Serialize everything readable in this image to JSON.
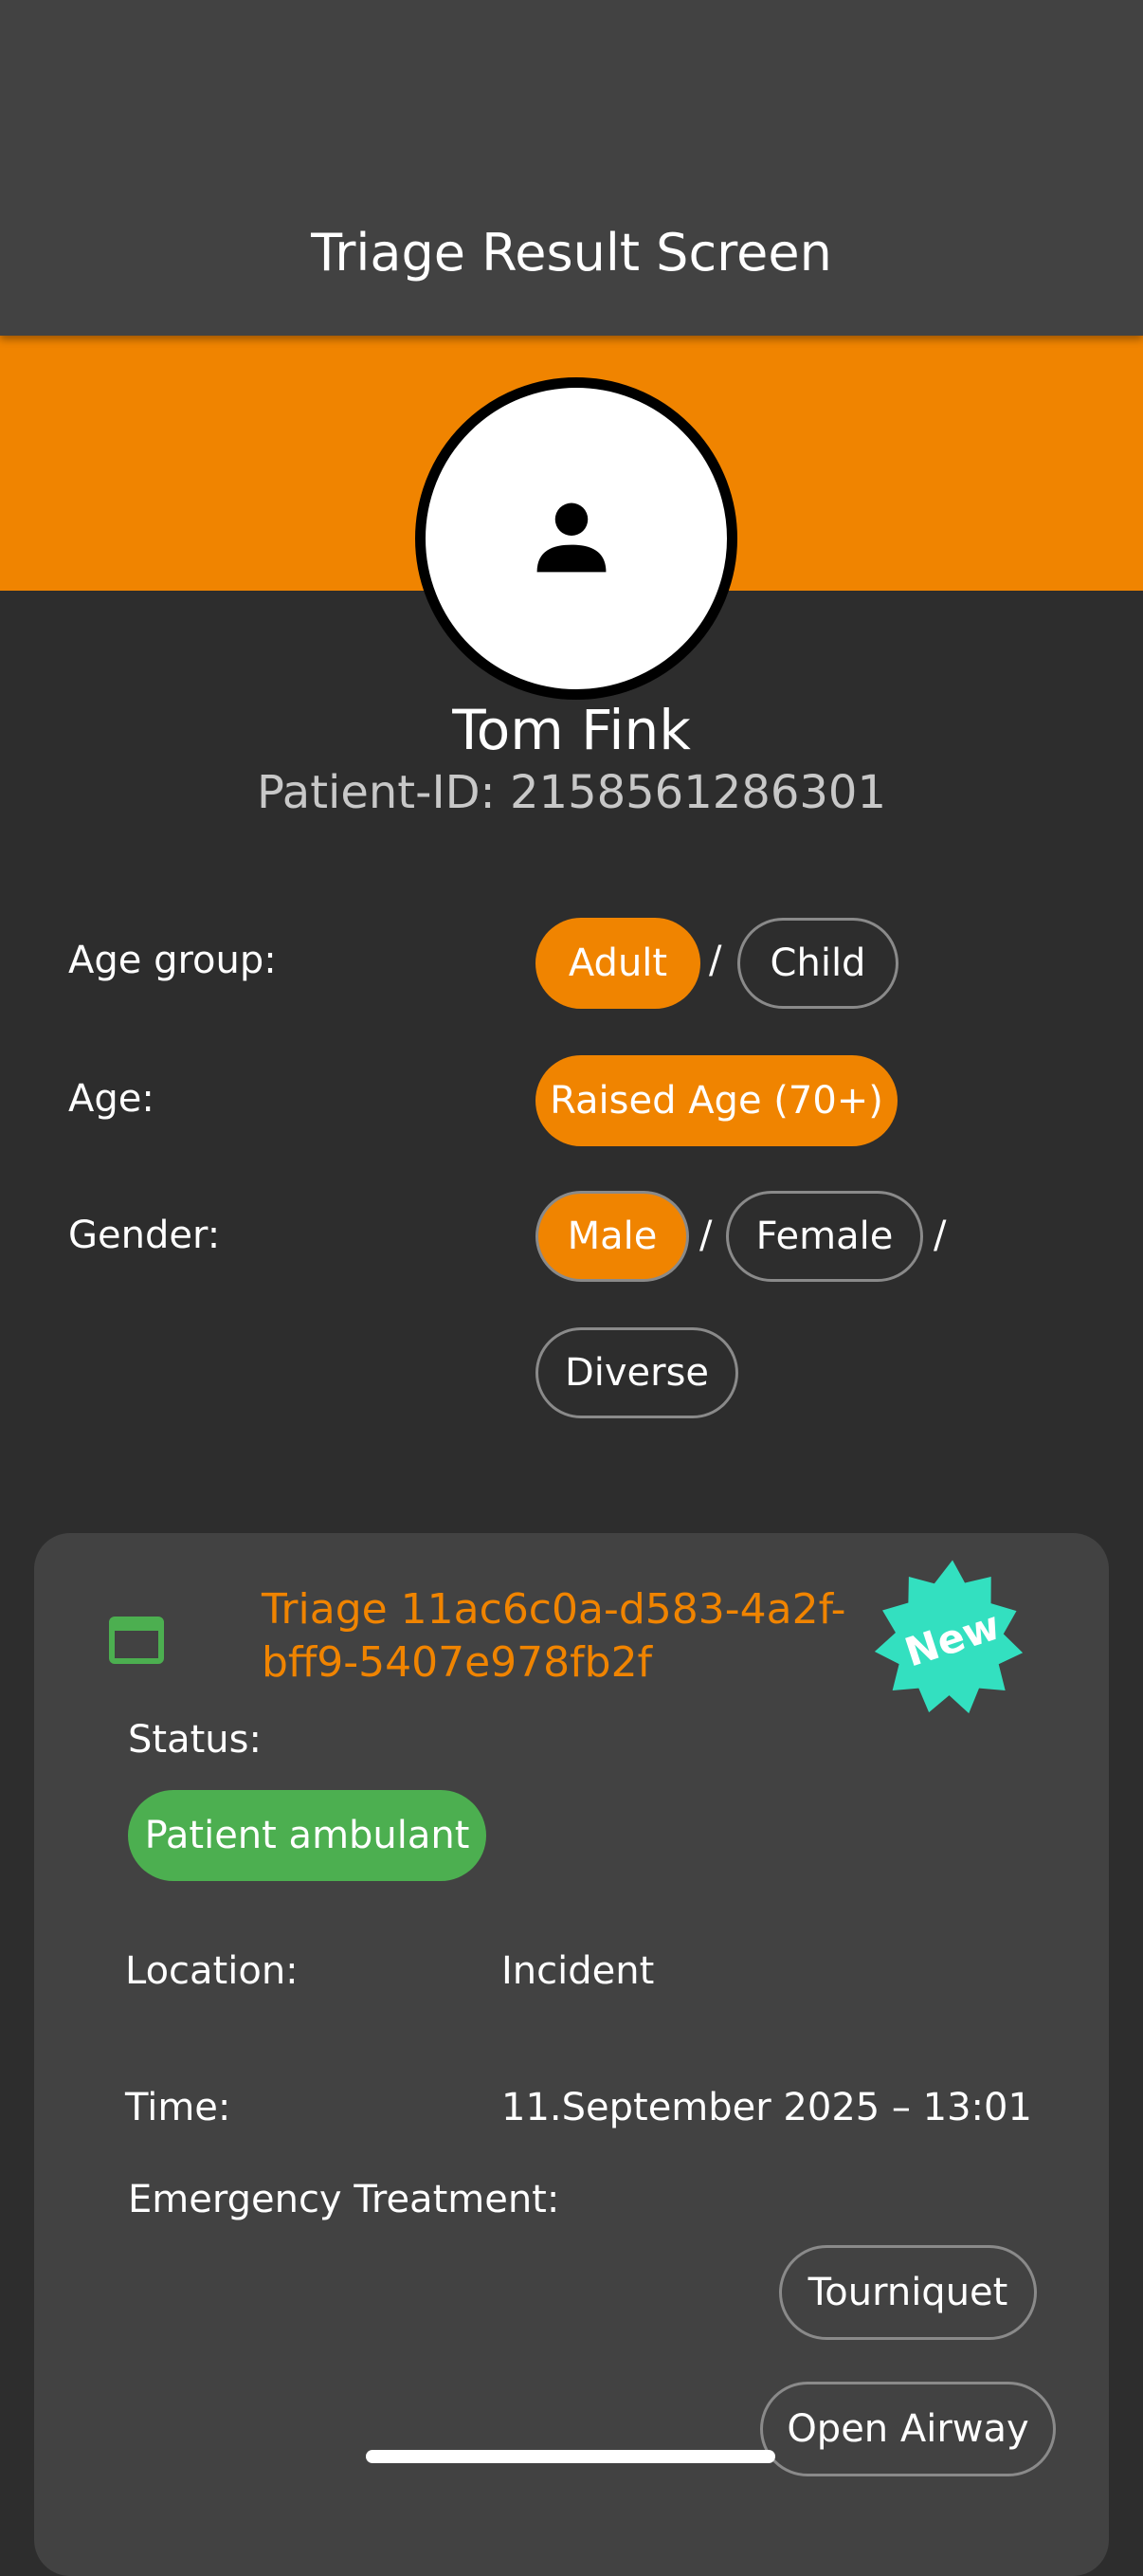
{
  "appbar": {
    "title": "Triage Result Screen"
  },
  "patient": {
    "avatar_icon": "person-icon",
    "name": "Tom Fink",
    "id_text": "Patient-ID: 2158561286301"
  },
  "attributes": {
    "age_group": {
      "label": "Age group:",
      "options": [
        "Adult",
        "Child"
      ],
      "selected": "Adult",
      "separator": "/"
    },
    "age": {
      "label": "Age:",
      "options": [
        "Raised Age (70+)"
      ],
      "selected": "Raised Age (70+)"
    },
    "gender": {
      "label": "Gender:",
      "options": [
        "Male",
        "Female",
        "Diverse"
      ],
      "selected": "Male",
      "separator": "/"
    }
  },
  "triage_card": {
    "icon": "window-icon",
    "title": "Triage 11ac6c0a-d583-4a2f-bff9-5407e978fb2f",
    "badge": "New",
    "status_label": "Status:",
    "status_value": "Patient ambulant",
    "location_label": "Location:",
    "location_value": "Incident",
    "time_label": "Time:",
    "time_value": "11.September 2025 – 13:01",
    "treatment_label": "Emergency Treatment:",
    "treatments": [
      "Tourniquet",
      "Open Airway"
    ]
  },
  "colors": {
    "accent": "#f08400",
    "status_green": "#4caf50",
    "badge_teal": "#33e0c0",
    "background": "#2d2d2d",
    "surface": "#424242"
  }
}
